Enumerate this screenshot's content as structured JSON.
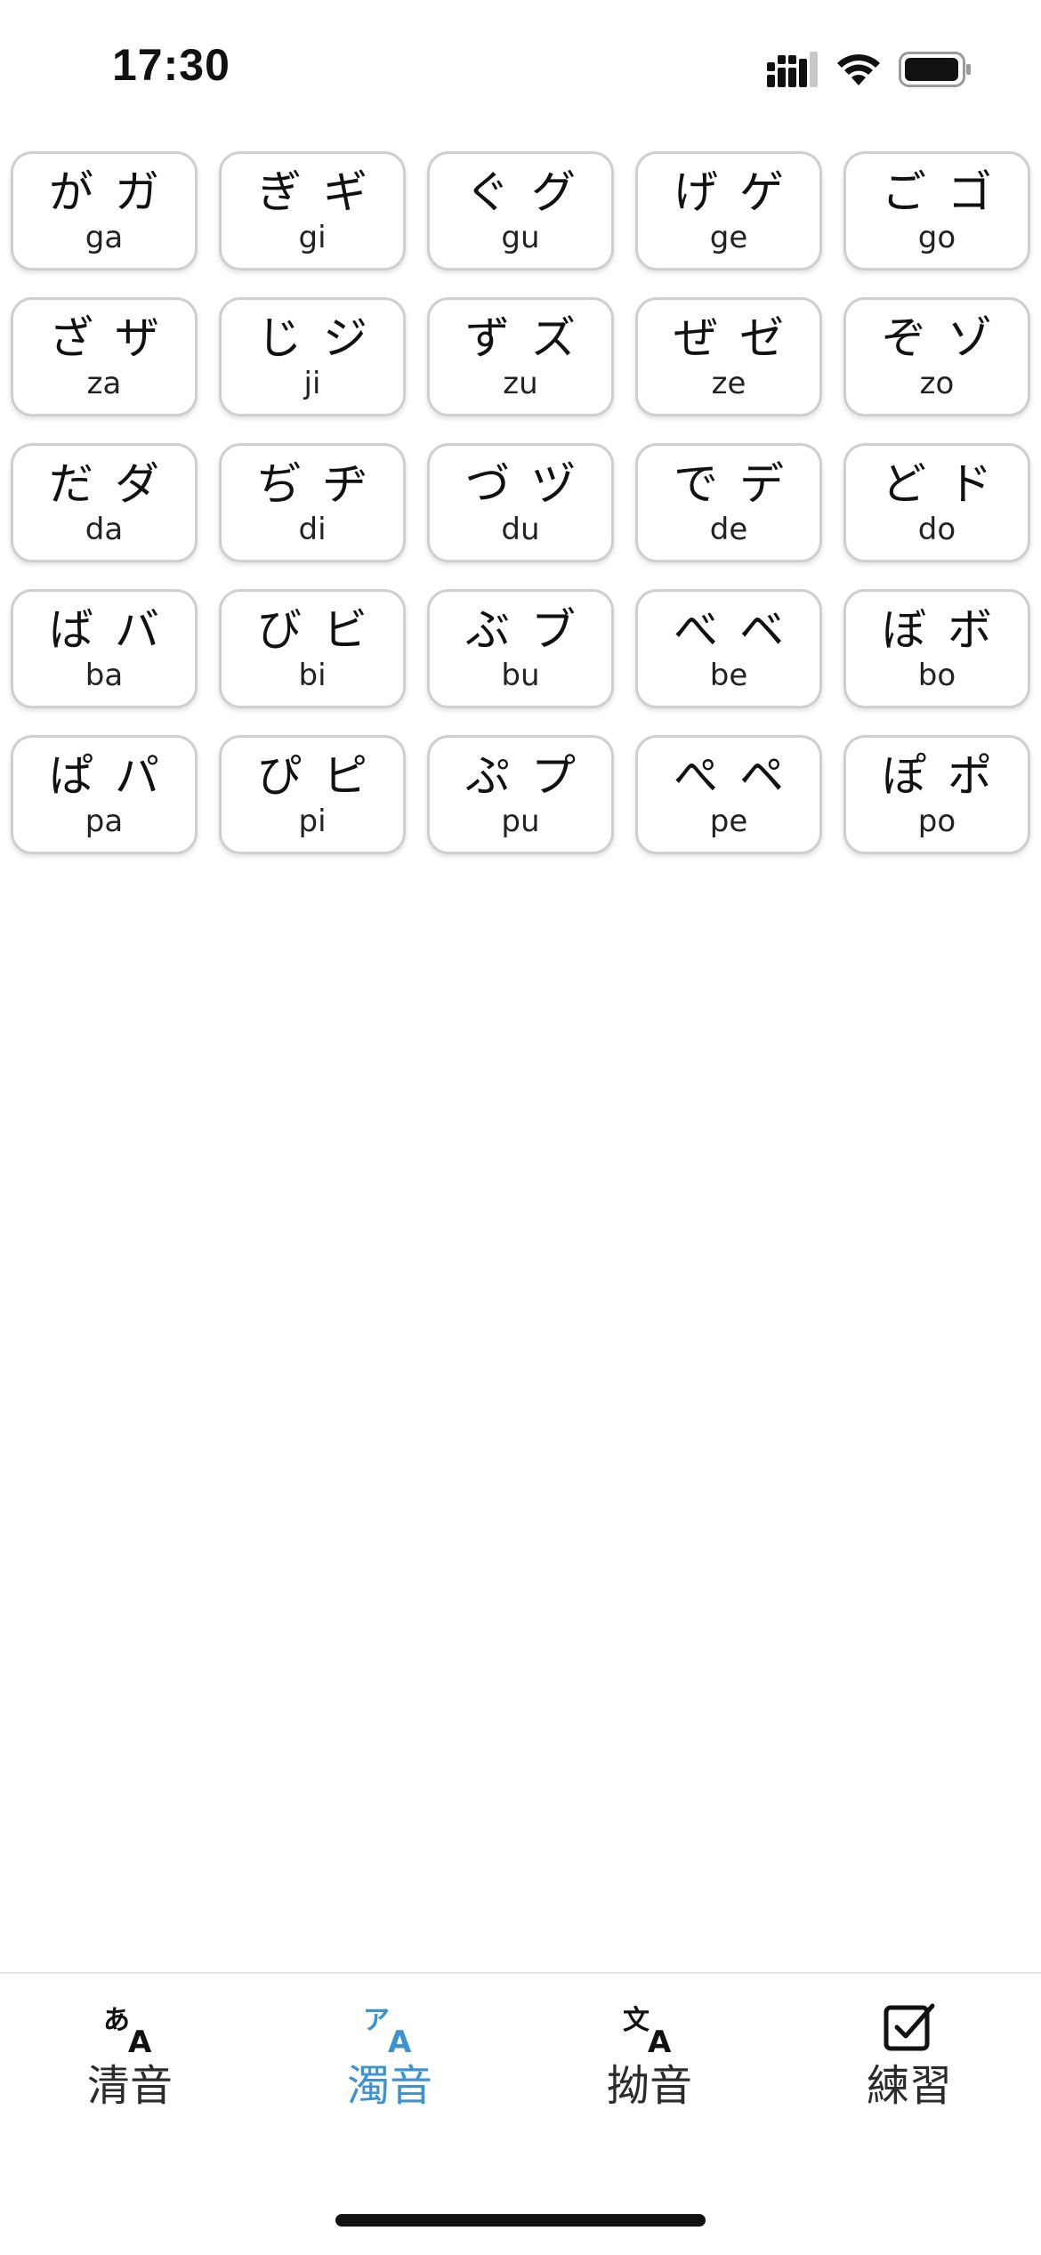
{
  "status_bar": {
    "time": "17:30"
  },
  "kana": [
    {
      "hiragana": "が",
      "katakana": "ガ",
      "romaji": "ga"
    },
    {
      "hiragana": "ぎ",
      "katakana": "ギ",
      "romaji": "gi"
    },
    {
      "hiragana": "ぐ",
      "katakana": "グ",
      "romaji": "gu"
    },
    {
      "hiragana": "げ",
      "katakana": "ゲ",
      "romaji": "ge"
    },
    {
      "hiragana": "ご",
      "katakana": "ゴ",
      "romaji": "go"
    },
    {
      "hiragana": "ざ",
      "katakana": "ザ",
      "romaji": "za"
    },
    {
      "hiragana": "じ",
      "katakana": "ジ",
      "romaji": "ji"
    },
    {
      "hiragana": "ず",
      "katakana": "ズ",
      "romaji": "zu"
    },
    {
      "hiragana": "ぜ",
      "katakana": "ゼ",
      "romaji": "ze"
    },
    {
      "hiragana": "ぞ",
      "katakana": "ゾ",
      "romaji": "zo"
    },
    {
      "hiragana": "だ",
      "katakana": "ダ",
      "romaji": "da"
    },
    {
      "hiragana": "ぢ",
      "katakana": "ヂ",
      "romaji": "di"
    },
    {
      "hiragana": "づ",
      "katakana": "ヅ",
      "romaji": "du"
    },
    {
      "hiragana": "で",
      "katakana": "デ",
      "romaji": "de"
    },
    {
      "hiragana": "ど",
      "katakana": "ド",
      "romaji": "do"
    },
    {
      "hiragana": "ば",
      "katakana": "バ",
      "romaji": "ba"
    },
    {
      "hiragana": "び",
      "katakana": "ビ",
      "romaji": "bi"
    },
    {
      "hiragana": "ぶ",
      "katakana": "ブ",
      "romaji": "bu"
    },
    {
      "hiragana": "べ",
      "katakana": "ベ",
      "romaji": "be"
    },
    {
      "hiragana": "ぼ",
      "katakana": "ボ",
      "romaji": "bo"
    },
    {
      "hiragana": "ぱ",
      "katakana": "パ",
      "romaji": "pa"
    },
    {
      "hiragana": "ぴ",
      "katakana": "ピ",
      "romaji": "pi"
    },
    {
      "hiragana": "ぷ",
      "katakana": "プ",
      "romaji": "pu"
    },
    {
      "hiragana": "ぺ",
      "katakana": "ペ",
      "romaji": "pe"
    },
    {
      "hiragana": "ぽ",
      "katakana": "ポ",
      "romaji": "po"
    }
  ],
  "tabs": [
    {
      "label": "清音",
      "icon": "hiragana-translate-icon",
      "active": false
    },
    {
      "label": "濁音",
      "icon": "katakana-translate-icon",
      "active": true
    },
    {
      "label": "拗音",
      "icon": "kanji-translate-icon",
      "active": false
    },
    {
      "label": "練習",
      "icon": "checkbox-icon",
      "active": false
    }
  ],
  "colors": {
    "accent": "#3d93d0",
    "tab_inactive": "#2b2b2b",
    "card_border": "#cfcfcf"
  }
}
